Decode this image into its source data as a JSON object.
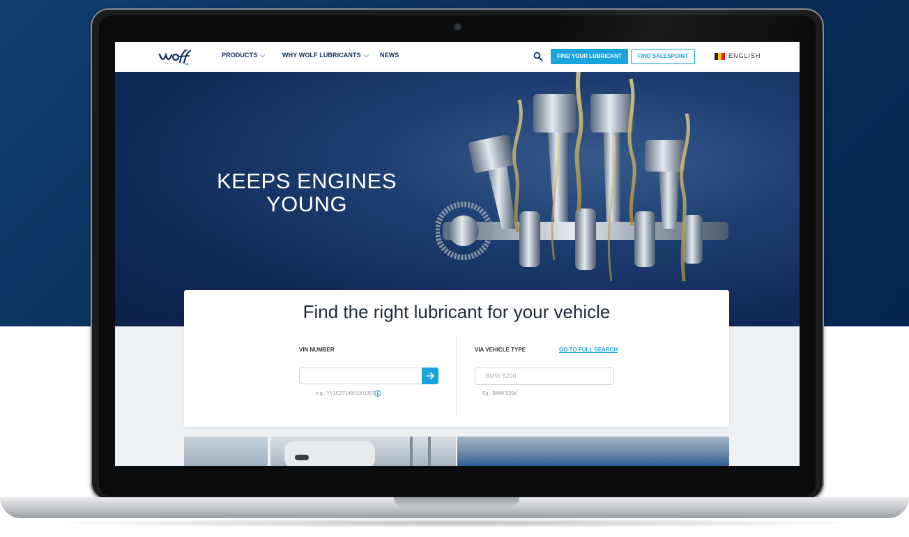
{
  "nav": {
    "products": "PRODUCTS",
    "why": "WHY WOLF LUBRICANTS",
    "news": "NEWS",
    "find_lubricant": "FIND YOUR LUBRICANT",
    "find_salespoint": "FIND SALESPOINT",
    "language": "ENGLISH"
  },
  "hero": {
    "line1": "KEEPS ENGINES",
    "line2": "YOUNG"
  },
  "search": {
    "title": "Find the right lubricant for your vehicle",
    "vin_label": "VIN NUMBER",
    "vin_example": "e.g.: YV1CZ714661301357",
    "vehicle_label": "VIA VEHICLE TYPE",
    "full_search": "GO TO FULL SEARCH",
    "vehicle_placeholder": "BMW 520d",
    "vehicle_example": "Eg.: BMW 520d"
  },
  "colors": {
    "accent": "#1aa3dc",
    "navy": "#0d2d5c",
    "background_blue": "#0a2f5c"
  }
}
